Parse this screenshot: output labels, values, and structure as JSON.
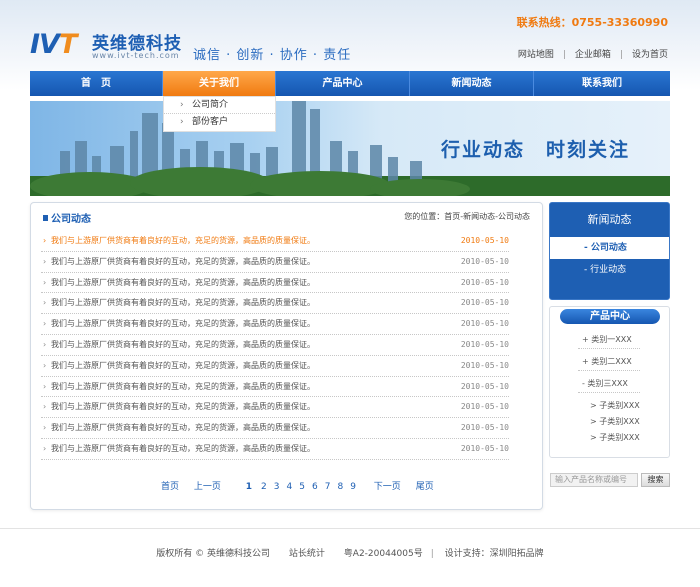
{
  "header": {
    "logo_mark_a": "IV",
    "logo_mark_b": "T",
    "company_cn": "英维德科技",
    "company_url": "www.ivt-tech.com",
    "slogan": "诚信 · 创新 · 协作 · 责任",
    "hotline": "联系热线：0755-33360990",
    "links": [
      "网站地图",
      "企业邮箱",
      "设为首页"
    ]
  },
  "nav": {
    "items": [
      "首　页",
      "关于我们",
      "产品中心",
      "新闻动态",
      "联系我们"
    ],
    "active_index": 1,
    "dropdown": [
      "公司简介",
      "部份客户"
    ]
  },
  "banner": {
    "slogan": "行业动态　时刻关注"
  },
  "main": {
    "title": "公司动态",
    "breadcrumb": "您的位置：首页-新闻动态-公司动态",
    "news": [
      {
        "title": "我们与上游原厂供货商有着良好的互动，充足的货源，高品质的质量保证。",
        "date": "2010-05-10"
      },
      {
        "title": "我们与上游原厂供货商有着良好的互动，充足的货源，高品质的质量保证。",
        "date": "2010-05-10"
      },
      {
        "title": "我们与上游原厂供货商有着良好的互动，充足的货源，高品质的质量保证。",
        "date": "2010-05-10"
      },
      {
        "title": "我们与上游原厂供货商有着良好的互动，充足的货源，高品质的质量保证。",
        "date": "2010-05-10"
      },
      {
        "title": "我们与上游原厂供货商有着良好的互动，充足的货源，高品质的质量保证。",
        "date": "2010-05-10"
      },
      {
        "title": "我们与上游原厂供货商有着良好的互动，充足的货源，高品质的质量保证。",
        "date": "2010-05-10"
      },
      {
        "title": "我们与上游原厂供货商有着良好的互动，充足的货源，高品质的质量保证。",
        "date": "2010-05-10"
      },
      {
        "title": "我们与上游原厂供货商有着良好的互动，充足的货源，高品质的质量保证。",
        "date": "2010-05-10"
      },
      {
        "title": "我们与上游原厂供货商有着良好的互动，充足的货源，高品质的质量保证。",
        "date": "2010-05-10"
      },
      {
        "title": "我们与上游原厂供货商有着良好的互动，充足的货源，高品质的质量保证。",
        "date": "2010-05-10"
      },
      {
        "title": "我们与上游原厂供货商有着良好的互动，充足的货源，高品质的质量保证。",
        "date": "2010-05-10"
      }
    ],
    "highlight_index": 0,
    "pager": {
      "first": "首页",
      "prev": "上一页",
      "pages": [
        "1",
        "2",
        "3",
        "4",
        "5",
        "6",
        "7",
        "8",
        "9"
      ],
      "current": "1",
      "next": "下一页",
      "last": "尾页"
    }
  },
  "side": {
    "news_title": "新闻动态",
    "news_items": [
      "- 公司动态",
      "- 行业动态"
    ],
    "news_active_index": 0,
    "products_title": "产品中心",
    "categories": [
      "+ 类别一XXX",
      "+ 类别二XXX",
      "- 类别三XXX"
    ],
    "subcategories": [
      "> 子类别XXX",
      "> 子类别XXX",
      "> 子类别XXX"
    ],
    "search_placeholder": "输入产品名称或编号",
    "search_button": "搜索"
  },
  "footer": {
    "copyright": "版权所有 © 英维德科技公司",
    "stats": "站长统计",
    "icp": "粤A2-20044005号",
    "design": "设计支持：深圳阳拓品牌"
  },
  "colors": {
    "brand_blue": "#1e5fb3",
    "accent_orange": "#f07a10"
  }
}
